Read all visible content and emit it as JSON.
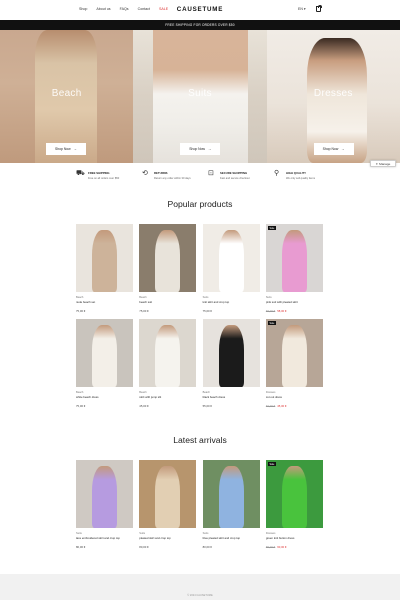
{
  "nav": {
    "links": [
      "Shop",
      "About us",
      "FAQs",
      "Contact",
      "SALE"
    ],
    "brand": "CAUSETUME",
    "language": "EN"
  },
  "promo": {
    "text": "FREE SHIPPING FOR ORDERS OVER $50"
  },
  "hero": {
    "panels": [
      {
        "label": "Beach",
        "button": "Shop Now"
      },
      {
        "label": "Suits",
        "button": "Shop Now"
      },
      {
        "label": "Dresses",
        "button": "Shop Now"
      }
    ]
  },
  "manage_button": "Manage",
  "features": [
    {
      "icon": "truck-icon",
      "title": "FREE SHIPPING",
      "subtitle": "Free on all orders over $50"
    },
    {
      "icon": "returns-icon",
      "title": "RETURNS",
      "subtitle": "Return any order within 30 days"
    },
    {
      "icon": "secure-shopping-icon",
      "title": "SECURE SHOPPING",
      "subtitle": "Fast and secure checkout"
    },
    {
      "icon": "quality-icon",
      "title": "HIGH QUALITY",
      "subtitle": "We only sell quality items"
    }
  ],
  "popular": {
    "title": "Popular products",
    "products": [
      {
        "category": "Beach",
        "name": "nude beach set",
        "price": "75,00 €",
        "old_price": "",
        "badge": "",
        "colors": [
          "#e9e4dd",
          "#cdb39a"
        ]
      },
      {
        "category": "Beach",
        "name": "beach suit",
        "price": "75,00 €",
        "old_price": "",
        "badge": "",
        "colors": [
          "#8a7d6c",
          "#e8e3da"
        ]
      },
      {
        "category": "Suits",
        "name": "knit skirt and crop top",
        "price": "75,00 €",
        "old_price": "",
        "badge": "",
        "colors": [
          "#f0ece6",
          "#ffffff"
        ]
      },
      {
        "category": "Suits",
        "name": "pink suit with pleated skirt",
        "price": "58,00 €",
        "old_price": "65,00 €",
        "badge": "Sale",
        "colors": [
          "#d9d6d4",
          "#e89bd1"
        ]
      },
      {
        "category": "Beach",
        "name": "white beach dress",
        "price": "75,00 €",
        "old_price": "",
        "badge": "",
        "colors": [
          "#c9c4bd",
          "#f3efe8"
        ]
      },
      {
        "category": "Beach",
        "name": "skirt with jump slit",
        "price": "45,00 €",
        "old_price": "",
        "badge": "",
        "colors": [
          "#dcd7cf",
          "#f5f3ee"
        ]
      },
      {
        "category": "Beach",
        "name": "black beach dress",
        "price": "55,00 €",
        "old_price": "",
        "badge": "",
        "colors": [
          "#e6e2dd",
          "#1b1b1b"
        ]
      },
      {
        "category": "Dresses",
        "name": "cut out dress",
        "price": "45,00 €",
        "old_price": "60,00 €",
        "badge": "Sale",
        "colors": [
          "#b7a697",
          "#f1e9dd"
        ]
      }
    ]
  },
  "latest": {
    "title": "Latest arrivals",
    "products": [
      {
        "category": "Suits",
        "name": "lace embroidered skirt and crop top",
        "price": "80,00 €",
        "old_price": "",
        "badge": "",
        "colors": [
          "#cfc9c3",
          "#b69be0"
        ]
      },
      {
        "category": "Suits",
        "name": "pleated skirt and crop top",
        "price": "80,00 €",
        "old_price": "",
        "badge": "",
        "colors": [
          "#b7956d",
          "#e2cfb3"
        ]
      },
      {
        "category": "Suits",
        "name": "blue pleated skirt and crop top",
        "price": "80,00 €",
        "old_price": "",
        "badge": "",
        "colors": [
          "#6f8f62",
          "#8fb3e0"
        ]
      },
      {
        "category": "Dresses",
        "name": "green knit button dress",
        "price": "60,00 €",
        "old_price": "85,00 €",
        "badge": "Sale",
        "colors": [
          "#3c9a3e",
          "#49c33d"
        ]
      }
    ]
  },
  "footer": {
    "copyright": "© 2024 CAUSETUME"
  }
}
